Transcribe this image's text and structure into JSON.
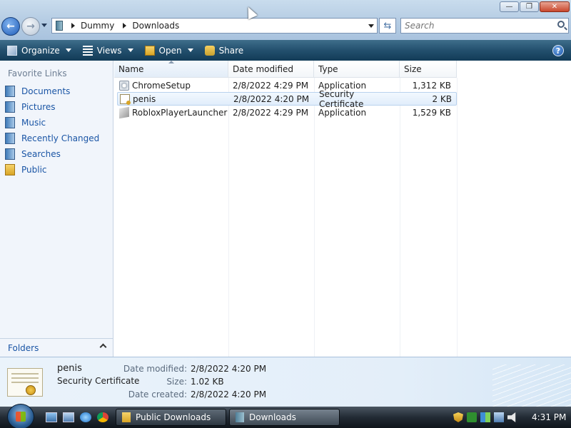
{
  "window": {
    "controls": {
      "minimize": "—",
      "maximize": "❐",
      "close": "✕"
    }
  },
  "address_bar": {
    "crumbs": [
      "Dummy",
      "Downloads"
    ]
  },
  "search": {
    "placeholder": "Search"
  },
  "toolbar": {
    "organize": "Organize",
    "views": "Views",
    "open": "Open",
    "share": "Share",
    "help": "?"
  },
  "sidebar": {
    "header": "Favorite Links",
    "items": [
      {
        "label": "Documents",
        "icon": "documents-icon"
      },
      {
        "label": "Pictures",
        "icon": "pictures-icon"
      },
      {
        "label": "Music",
        "icon": "music-icon"
      },
      {
        "label": "Recently Changed",
        "icon": "recently-changed-icon"
      },
      {
        "label": "Searches",
        "icon": "searches-icon"
      },
      {
        "label": "Public",
        "icon": "public-folder-icon"
      }
    ],
    "folders_label": "Folders"
  },
  "file_list": {
    "columns": [
      "Name",
      "Date modified",
      "Type",
      "Size"
    ],
    "rows": [
      {
        "name": "ChromeSetup",
        "date": "2/8/2022 4:29 PM",
        "type": "Application",
        "size": "1,312 KB",
        "selected": false
      },
      {
        "name": "penis",
        "date": "2/8/2022 4:20 PM",
        "type": "Security Certificate",
        "size": "2 KB",
        "selected": true
      },
      {
        "name": "RobloxPlayerLauncher",
        "date": "2/8/2022 4:29 PM",
        "type": "Application",
        "size": "1,529 KB",
        "selected": false
      }
    ]
  },
  "details": {
    "name": "penis",
    "type": "Security Certificate",
    "date_modified_label": "Date modified:",
    "date_modified": "2/8/2022 4:20 PM",
    "size_label": "Size:",
    "size": "1.02 KB",
    "date_created_label": "Date created:",
    "date_created": "2/8/2022 4:20 PM"
  },
  "taskbar": {
    "tasks": [
      "Public Downloads",
      "Downloads"
    ],
    "clock": "4:31 PM"
  },
  "colors": {
    "link_blue": "#1a55a5",
    "command_bar": "#23506e",
    "selection": "#e1edfb"
  }
}
